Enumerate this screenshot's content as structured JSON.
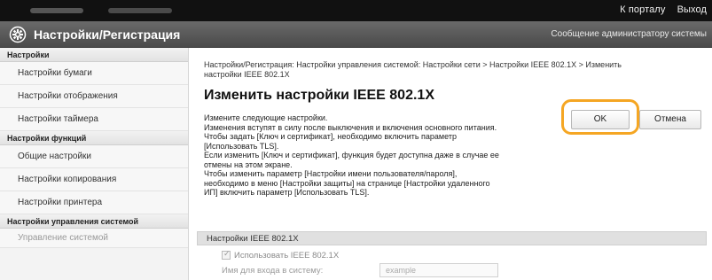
{
  "topbar": {
    "links": [
      "К порталу",
      "Выход"
    ]
  },
  "header": {
    "title": "Настройки/Регистрация",
    "message": "Сообщение администратору системы"
  },
  "sidebar": {
    "groups": [
      {
        "label": "Настройки",
        "items": [
          "Настройки бумаги",
          "Настройки отображения",
          "Настройки таймера"
        ]
      },
      {
        "label": "Настройки функций",
        "items": [
          "Общие настройки",
          "Настройки копирования",
          "Настройки принтера"
        ]
      },
      {
        "label": "Настройки управления системой",
        "items": [
          "Управление системой"
        ]
      }
    ]
  },
  "main": {
    "breadcrumb_line1": "Настройки/Регистрация: Настройки управления системой: Настройки сети > Настройки IEEE 802.1X > Изменить",
    "breadcrumb_line2": "настройки IEEE 802.1X",
    "page_title": "Изменить настройки IEEE 802.1X",
    "description": [
      "Измените следующие настройки.",
      "Изменения вступят в силу после выключения и включения основного питания.",
      "Чтобы задать [Ключ и сертификат], необходимо включить параметр",
      "[Использовать TLS].",
      "Если изменить [Ключ и сертификат], функция будет доступна даже в случае ее",
      "отмены на этом экране.",
      "Чтобы изменить параметр [Настройки имени пользователя/пароля],",
      "необходимо в меню [Настройки защиты] на странице [Настройки удаленного",
      "ИП] включить параметр [Использовать TLS]."
    ],
    "ok_label": "OK",
    "cancel_label": "Отмена",
    "section_title": "Настройки IEEE 802.1X",
    "use_ieee_label": "Использовать IEEE 802.1X",
    "login_name_label": "Имя для входа в систему:",
    "login_name_value": "example"
  },
  "colors": {
    "highlight": "#f5a623",
    "header_bg": "#5a5a5a",
    "topbar_bg": "#111111"
  },
  "icons": {
    "header": "gear-icon"
  }
}
